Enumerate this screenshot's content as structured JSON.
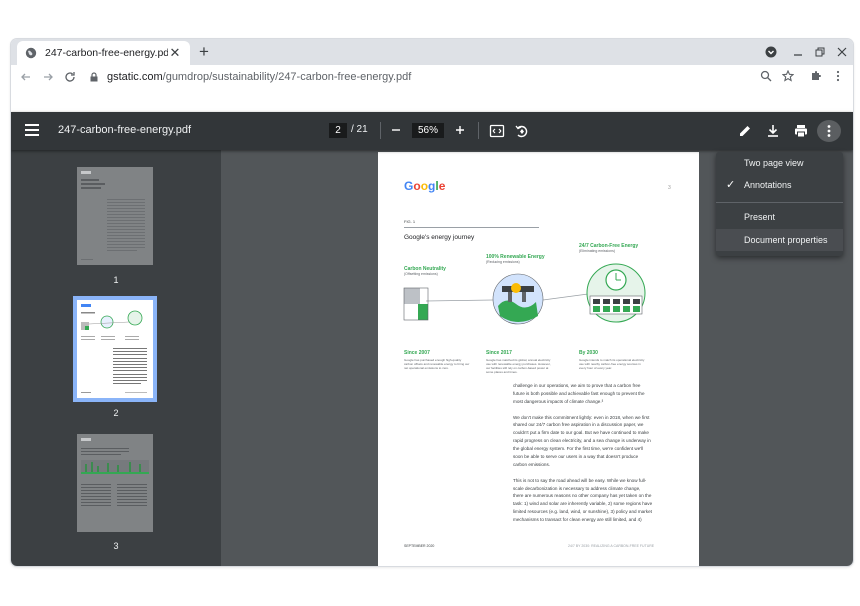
{
  "browser": {
    "tab_title": "247-carbon-free-energy.pdf",
    "tab_close": "✕",
    "new_tab": "+",
    "url_domain": "gstatic.com",
    "url_path": "/gumdrop/sustainability/247-carbon-free-energy.pdf"
  },
  "pdf_toolbar": {
    "filename": "247-carbon-free-energy.pdf",
    "current_page": "2",
    "total_pages": "/ 21",
    "zoom": "56%"
  },
  "menu": {
    "items": [
      {
        "label": "Two page view",
        "checked": false
      },
      {
        "label": "Annotations",
        "checked": true
      },
      {
        "label": "Present",
        "checked": false
      },
      {
        "label": "Document properties",
        "checked": false
      }
    ],
    "check_glyph": "✓"
  },
  "thumbnails": [
    {
      "label": "1"
    },
    {
      "label": "2"
    },
    {
      "label": "3"
    }
  ],
  "page": {
    "logo": "Google",
    "fig_label": "FIG. 1",
    "fig_title": "Google's energy journey",
    "stage1": {
      "title": "Carbon Neutrality",
      "sub": "(Offsetting emissions)",
      "since": "Since 2007",
      "desc": "Google has purchased enough high-quality carbon offsets and renewable energy to bring our net operational emissions to zero."
    },
    "stage2": {
      "title": "100% Renewable Energy",
      "sub": "(Reducing emissions)",
      "since": "Since 2017",
      "desc": "Google has matched its global, annual electricity use with renewable energy purchases. However, our facilities still rely on carbon-based power at some places and times."
    },
    "stage3": {
      "title": "24/7 Carbon-Free Energy",
      "sub": "(Eliminating emissions)",
      "since": "By 2030",
      "desc": "Google intends to match its operational electricity use with nearby carbon-free energy sources in every hour of every year."
    },
    "body": [
      "challenge in our operations, we aim to prove that a carbon free",
      "future is both possible and achievable fast enough to prevent the",
      "most dangerous impacts of climate change.³",
      "",
      "We don't make this commitment lightly: even in 2018, when we first",
      "shared our 24/7 carbon free aspiration in a discussion paper, we",
      "couldn't put a firm date to our goal. But we have continued to make",
      "rapid progress on clean electricity, and a sea change is underway in",
      "the global energy system. For the first time, we're confident we'll",
      "soon be able to serve our users in a way that doesn't produce",
      "carbon emissions.",
      "",
      "This is not to say the road ahead will be easy. While we know full-",
      "scale decarbonization is necessary to address climate change,",
      "there are numerous reasons no other company has yet taken on the",
      "task: 1) wind and solar are inherently variable, 2) some regions have",
      "limited resources (e.g. land, wind, or sunshine), 3) policy and market",
      "mechanisms to transact for clean energy are still limited, and 4)"
    ],
    "footer_left": "SEPTEMBER 2020",
    "footer_right": "24/7 BY 2030: REALIZING A CARBON-FREE FUTURE",
    "page_mark": "3"
  }
}
